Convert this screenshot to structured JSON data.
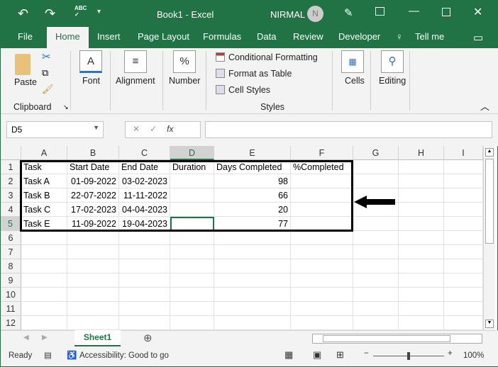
{
  "title_bar": {
    "doc_title": "Book1  -  Excel",
    "user": "NIRMAL",
    "avatar_initial": "N"
  },
  "tabs": [
    "File",
    "Home",
    "Insert",
    "Page Layout",
    "Formulas",
    "Data",
    "Review",
    "Developer",
    "Tell me"
  ],
  "ribbon": {
    "paste": "Paste",
    "clipboard": "Clipboard",
    "font": "Font",
    "alignment": "Alignment",
    "number": "Number",
    "conditional_formatting": "Conditional Formatting",
    "format_as_table": "Format as Table",
    "cell_styles": "Cell Styles",
    "styles": "Styles",
    "cells": "Cells",
    "editing": "Editing"
  },
  "formula_bar": {
    "name_box": "D5",
    "fx": "fx",
    "formula": ""
  },
  "columns": [
    "A",
    "B",
    "C",
    "D",
    "E",
    "F",
    "G",
    "H",
    "I"
  ],
  "rows": [
    "1",
    "2",
    "3",
    "4",
    "5",
    "6",
    "7",
    "8",
    "9",
    "10",
    "11",
    "12"
  ],
  "cells": [
    [
      "Task",
      "Start Date",
      "End Date",
      "Duration",
      "Days Completed",
      "%Completed"
    ],
    [
      "Task A",
      "01-09-2022",
      "03-02-2023",
      "",
      "98",
      ""
    ],
    [
      "Task B",
      "22-07-2022",
      "11-11-2022",
      "",
      "66",
      ""
    ],
    [
      "Task C",
      "17-02-2023",
      "04-04-2023",
      "",
      "20",
      ""
    ],
    [
      "Task E",
      "11-09-2022",
      "19-04-2023",
      "",
      "77",
      ""
    ]
  ],
  "sheet_tab": "Sheet1",
  "status": {
    "ready": "Ready",
    "accessibility": "Accessibility: Good to go",
    "zoom": "100%"
  }
}
